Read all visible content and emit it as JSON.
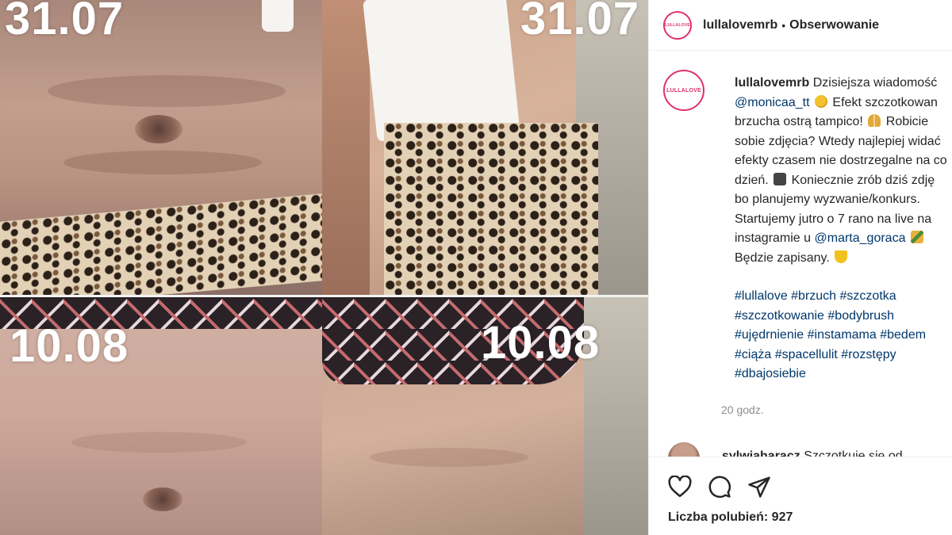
{
  "photo": {
    "date_top_left": "31.07",
    "date_top_right": "31.07",
    "date_bottom_left": "10.08",
    "date_bottom_right": "10.08"
  },
  "header": {
    "username": "lullalovemrb",
    "separator": "•",
    "follow_label": "Obserwowanie",
    "avatar_text": "LULLALOVE"
  },
  "caption": {
    "username": "lullalovemrb",
    "line1_text": "Dzisiejsza wiadomość",
    "mention1": "@monicaa_tt",
    "line2_text": "Efekt szczotkowan",
    "line3_text": "brzucha ostrą tampico!",
    "line3b_text": "Robicie",
    "line4_text": "sobie zdjęcia? Wtedy najlepiej widać",
    "line5_text": "efekty czasem nie dostrzegalne na co",
    "line6a_text": "dzień.",
    "line6b_text": "Koniecznie zrób dziś zdję",
    "line7_text": "bo planujemy wyzwanie/konkurs.",
    "line8_text": "Startujemy jutro o 7 rano na live na",
    "line9a_text": "instagramie u",
    "mention2": "@marta_goraca",
    "line10_text": "Będzie zapisany.",
    "hashtags_line1": "#lullalove #brzuch #szczotka",
    "hashtags_line2": "#szczotkowanie #bodybrush",
    "hashtags_line3": "#ujędrnienie #instamama #bedem",
    "hashtags_line4": "#ciąża #spacellulit #rozstępy",
    "hashtags_line5": "#dbajosiebie"
  },
  "timestamp": "20 godz.",
  "comment2": {
    "username": "sylwiaharacz",
    "text": "Szczotkuje się od"
  },
  "actions": {
    "likes_label": "Liczba polubień: 927",
    "icons": [
      "heart-icon",
      "comment-icon",
      "share-icon"
    ]
  }
}
